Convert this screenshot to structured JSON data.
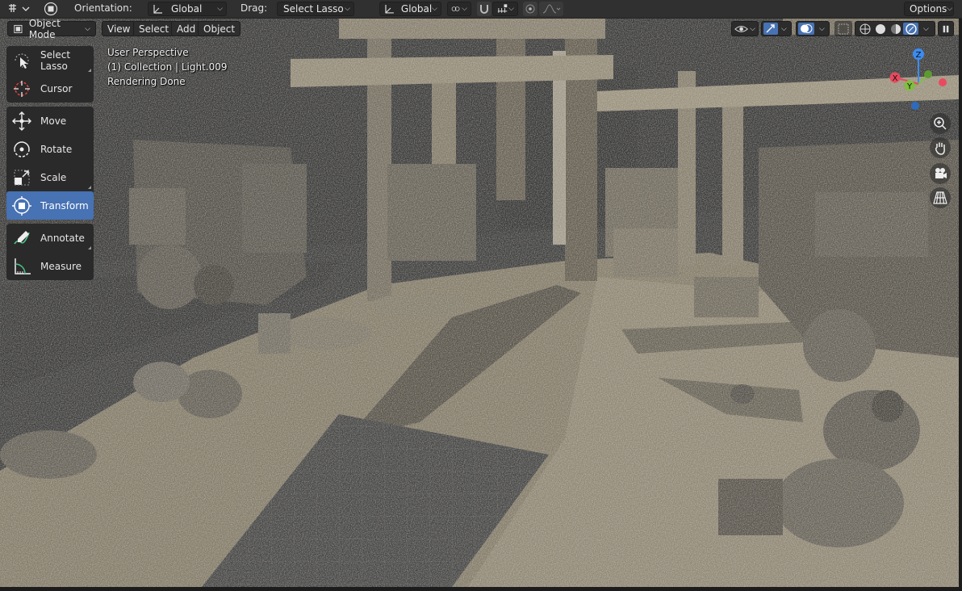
{
  "header": {
    "orientation_label": "Orientation:",
    "orientation_value": "Global",
    "drag_label": "Drag:",
    "drag_value": "Select Lasso",
    "transform_pivot_value": "Global",
    "options_label": "Options"
  },
  "viewport_header": {
    "mode": "Object Mode",
    "menus": [
      "View",
      "Select",
      "Add",
      "Object"
    ]
  },
  "toolbar": {
    "tools": [
      {
        "label": "Select Lasso",
        "icon": "select-lasso-icon"
      },
      {
        "label": "Cursor",
        "icon": "cursor-icon"
      },
      {
        "label": "Move",
        "icon": "move-icon"
      },
      {
        "label": "Rotate",
        "icon": "rotate-icon"
      },
      {
        "label": "Scale",
        "icon": "scale-icon"
      },
      {
        "label": "Transform",
        "icon": "transform-icon",
        "active": true
      },
      {
        "label": "Annotate",
        "icon": "annotate-icon"
      },
      {
        "label": "Measure",
        "icon": "measure-icon"
      }
    ]
  },
  "overlay": {
    "view_name": "User Perspective",
    "collection": "(1) Collection | Light.009",
    "status": "Rendering Done"
  },
  "gizmo": {
    "axes": {
      "z": "Z",
      "x": "X",
      "y": "Y"
    },
    "colors": {
      "x": "#e84a5f",
      "y": "#7fbf3f",
      "z": "#3c8cf0"
    }
  },
  "accent_color": "#4772b3"
}
